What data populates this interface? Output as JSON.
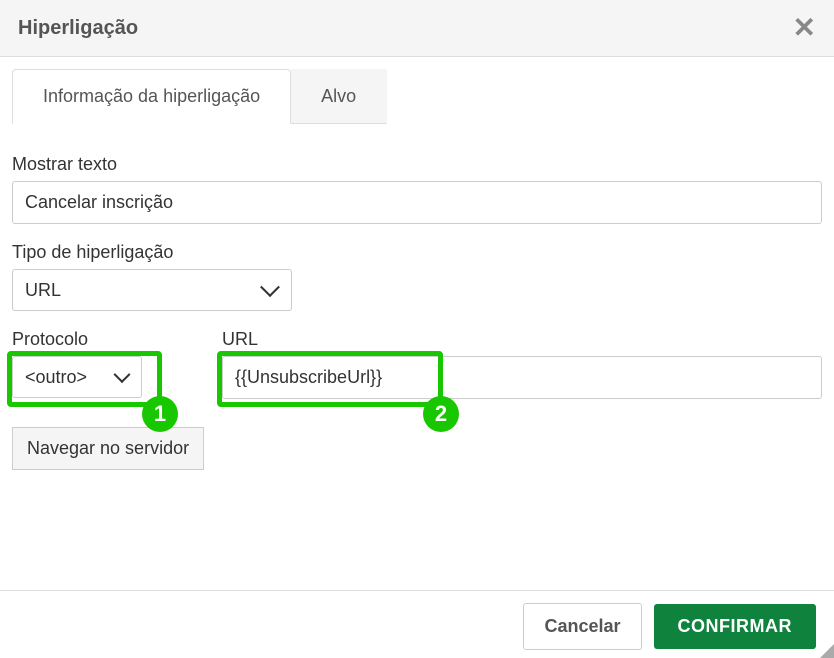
{
  "dialog": {
    "title": "Hiperligação"
  },
  "tabs": {
    "info": "Informação da hiperligação",
    "target": "Alvo"
  },
  "fields": {
    "display_text_label": "Mostrar texto",
    "display_text_value": "Cancelar inscrição",
    "link_type_label": "Tipo de hiperligação",
    "link_type_value": "URL",
    "protocol_label": "Protocolo",
    "protocol_value": "<outro>",
    "url_label": "URL",
    "url_value": "{{UnsubscribeUrl}}",
    "browse_label": "Navegar no servidor"
  },
  "annotations": {
    "badge1": "1",
    "badge2": "2"
  },
  "footer": {
    "cancel": "Cancelar",
    "confirm": "CONFIRMAR"
  }
}
